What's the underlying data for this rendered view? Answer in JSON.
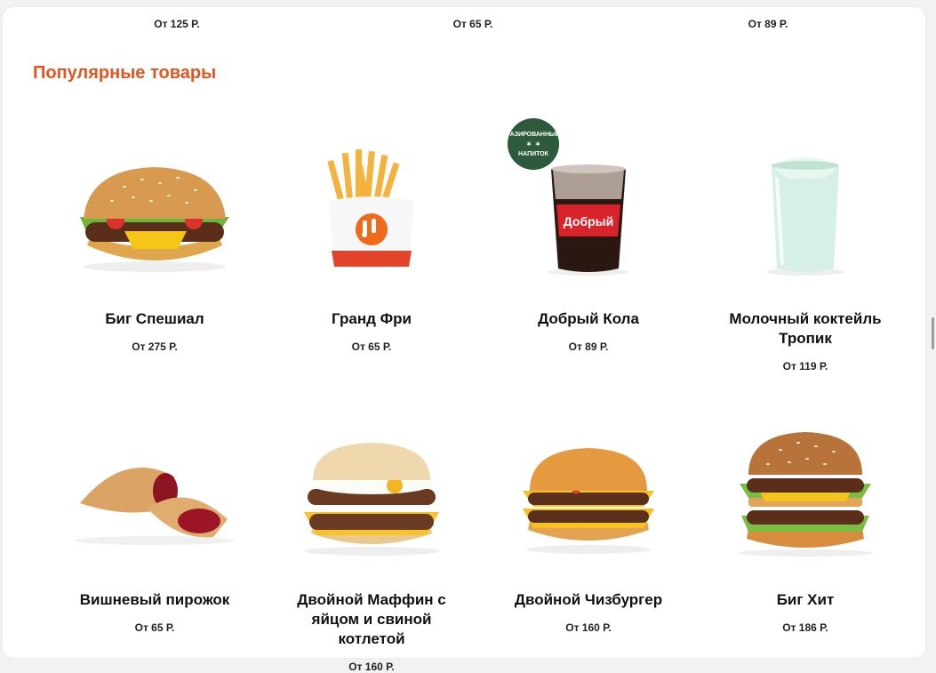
{
  "top_prices": [
    "От 125 Р.",
    "От 65 Р.",
    "От 89 Р."
  ],
  "section": {
    "title": "Популярные товары"
  },
  "badge": {
    "line1": "ГАЗИРОВАННЫЙ",
    "line2": "НАПИТОК",
    "color": "#2d5a3c"
  },
  "cola_cup_label": "Добрый",
  "colors": {
    "accent": "#e8541f"
  },
  "products": [
    {
      "name": "Биг Спешиал",
      "price": "От 275 Р.",
      "icon": "burger-icon"
    },
    {
      "name": "Гранд Фри",
      "price": "От 65 Р.",
      "icon": "fries-icon"
    },
    {
      "name": "Добрый Кола",
      "price": "От 89 Р.",
      "icon": "cola-cup-icon"
    },
    {
      "name": "Молочный коктейль Тропик",
      "price": "От 119 Р.",
      "icon": "milkshake-icon"
    },
    {
      "name": "Вишневый пирожок",
      "price": "От 65 Р.",
      "icon": "pie-icon"
    },
    {
      "name": "Двойной Маффин с яйцом и свиной котлетой",
      "price": "От 160 Р.",
      "icon": "muffin-icon"
    },
    {
      "name": "Двойной Чизбургер",
      "price": "От 160 Р.",
      "icon": "cheeseburger-icon"
    },
    {
      "name": "Биг Хит",
      "price": "От 186 Р.",
      "icon": "big-burger-icon"
    }
  ]
}
